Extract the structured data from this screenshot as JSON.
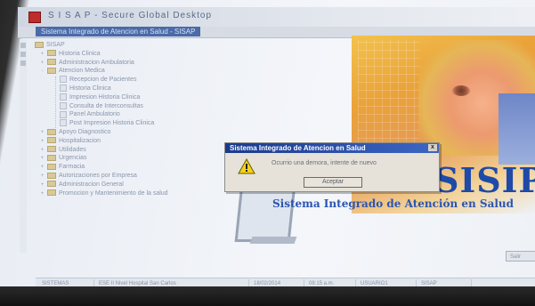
{
  "window": {
    "title": "S I S A P - Secure Global Desktop",
    "path": "Sistema Integrado de Atencion en Salud - SISAP"
  },
  "tree": {
    "items": [
      {
        "label": "SISAP",
        "level": 0,
        "kind": "root",
        "toggle": ""
      },
      {
        "label": "Historia Clinica",
        "level": 1,
        "kind": "folder",
        "toggle": "+"
      },
      {
        "label": "Administracion Ambulatoria",
        "level": 1,
        "kind": "folder",
        "toggle": "+"
      },
      {
        "label": "Atencion Medica",
        "level": 1,
        "kind": "folder",
        "toggle": "-"
      },
      {
        "label": "Recepcion de Pacientes",
        "level": 2,
        "kind": "leaf",
        "toggle": ""
      },
      {
        "label": "Historia Clinica",
        "level": 2,
        "kind": "leaf",
        "toggle": ""
      },
      {
        "label": "Impresion Historia Clinica",
        "level": 2,
        "kind": "leaf",
        "toggle": ""
      },
      {
        "label": "Consulta de Interconsultas",
        "level": 2,
        "kind": "leaf",
        "toggle": ""
      },
      {
        "label": "Panel Ambulatorio",
        "level": 2,
        "kind": "leaf",
        "toggle": ""
      },
      {
        "label": "Post Impresion Historia Clinica",
        "level": 2,
        "kind": "leaf",
        "toggle": ""
      },
      {
        "label": "Apoyo Diagnostico",
        "level": 1,
        "kind": "folder",
        "toggle": "+"
      },
      {
        "label": "Hospitalizacion",
        "level": 1,
        "kind": "folder",
        "toggle": "+"
      },
      {
        "label": "Utilidades",
        "level": 1,
        "kind": "folder",
        "toggle": "+"
      },
      {
        "label": "Urgencias",
        "level": 1,
        "kind": "folder",
        "toggle": "+"
      },
      {
        "label": "Farmacia",
        "level": 1,
        "kind": "folder",
        "toggle": "+"
      },
      {
        "label": "Autorizaciones por Empresa",
        "level": 1,
        "kind": "folder",
        "toggle": "+"
      },
      {
        "label": "Administracion General",
        "level": 1,
        "kind": "folder",
        "toggle": "+"
      },
      {
        "label": "Promocion y Mantenimiento de la salud",
        "level": 1,
        "kind": "folder",
        "toggle": "+"
      }
    ]
  },
  "splash": {
    "brand": "SISIP",
    "tagline": "Sistema Integrado de Atención en Salud"
  },
  "dialog": {
    "title": "Sistema Integrado de Atencion en Salud",
    "close_label": "x",
    "icon": "warning-icon",
    "message": "Ocurrio una demora, intente de nuevo",
    "button_label": "Aceptar"
  },
  "side_button": {
    "label": "Salir"
  },
  "statusbar": {
    "segments": [
      "SISTEMAS",
      "ESE II Nivel Hospital San Carlos",
      "18/02/2014",
      "08:15 a.m.",
      "USUARIO1",
      "SISAP"
    ]
  },
  "colors": {
    "dialog_title": "#1a3a8c",
    "brand_blue": "#1e4aa8",
    "app_icon": "#c02b2b"
  }
}
